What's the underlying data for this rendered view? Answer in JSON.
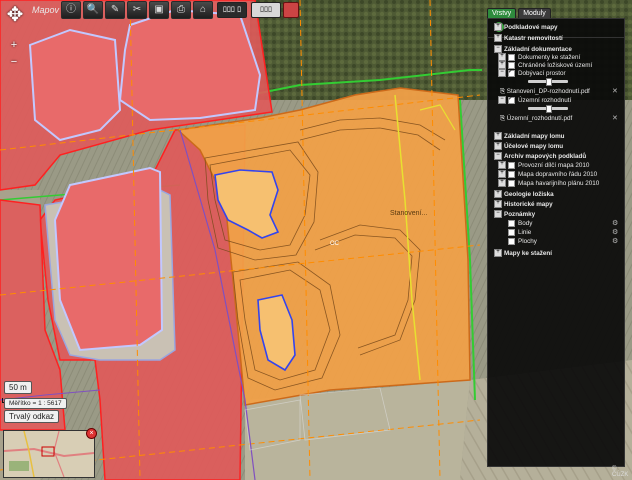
{
  "toolbar": {
    "title_text": "Mapov",
    "buttons": [
      "ⓘ",
      "🔍",
      "✎",
      "✂",
      "▣",
      "⎙",
      "⌂"
    ],
    "tool_a": "ﾛﾛﾛ ﾛ",
    "tool_b": "ﾛﾛﾛ"
  },
  "map_controls": {
    "scale_label": "50 m",
    "measure_label": "Měřítko = 1 : 5617",
    "current_button": "Trvalý odkaz"
  },
  "map_labels": {
    "lom_east": "Stanovení...",
    "center_label": "OC"
  },
  "panel": {
    "tabs": [
      "Vrstvy",
      "Moduly"
    ],
    "logo": "L",
    "items": [
      {
        "label": "Podkladové mapy",
        "level": 0,
        "bold": true,
        "toggle": "+"
      },
      {
        "label": "Katastr nemovitostí",
        "level": 0,
        "bold": true,
        "toggle": "+"
      },
      {
        "label": "Základní dokumentace",
        "level": 0,
        "bold": true,
        "toggle": "−"
      },
      {
        "label": "Dokumenty ke stažení",
        "level": 1,
        "checkbox": false,
        "toggle": "+"
      },
      {
        "label": "Chráněné ložiskové území",
        "level": 1,
        "checkbox": false,
        "toggle": "+"
      },
      {
        "label": "Dobývací prostor",
        "level": 1,
        "checkbox": true,
        "toggle": "−"
      },
      {
        "label": "Stanovení_DP-rozhodnutí.pdf",
        "level": 2,
        "file": true
      },
      {
        "label": "Územní rozhodnutí",
        "level": 1,
        "checkbox": true,
        "toggle": "−"
      },
      {
        "label": "Územní_rozhodnutí.pdf",
        "level": 2,
        "file": true
      },
      {
        "label": "Základní mapy lomu",
        "level": 0,
        "bold": true,
        "toggle": "+"
      },
      {
        "label": "Účelové mapy lomu",
        "level": 0,
        "bold": true,
        "toggle": "+"
      },
      {
        "label": "Archiv mapových podkladů",
        "level": 0,
        "bold": true,
        "toggle": "−"
      },
      {
        "label": "Provozní dílčí mapa 2010",
        "level": 1,
        "checkbox": false,
        "toggle": "+"
      },
      {
        "label": "Mapa dopravního řádu 2010",
        "level": 1,
        "checkbox": false,
        "toggle": "+"
      },
      {
        "label": "Mapa havarijního plánu 2010",
        "level": 1,
        "checkbox": false,
        "toggle": "+"
      },
      {
        "label": "Geologie ložiska",
        "level": 0,
        "bold": true,
        "toggle": "+"
      },
      {
        "label": "Historické mapy",
        "level": 0,
        "bold": true,
        "toggle": "+"
      },
      {
        "label": "Poznámky",
        "level": 0,
        "bold": true,
        "toggle": "−"
      },
      {
        "label": "Body",
        "level": 1,
        "checkbox": false
      },
      {
        "label": "Linie",
        "level": 1,
        "checkbox": false
      },
      {
        "label": "Plochy",
        "level": 1,
        "checkbox": false
      },
      {
        "label": "Mapy ke stažení",
        "level": 0,
        "bold": true,
        "toggle": "+"
      }
    ],
    "footer": "© ČÚZK"
  }
}
